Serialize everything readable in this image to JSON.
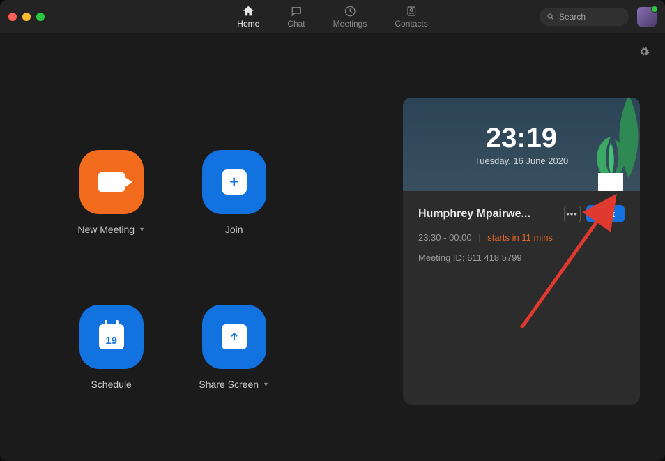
{
  "nav": {
    "tabs": [
      {
        "label": "Home"
      },
      {
        "label": "Chat"
      },
      {
        "label": "Meetings"
      },
      {
        "label": "Contacts"
      }
    ],
    "active_index": 0
  },
  "search": {
    "placeholder": "Search"
  },
  "tiles": {
    "new_meeting": {
      "label": "New Meeting"
    },
    "join": {
      "label": "Join"
    },
    "schedule": {
      "label": "Schedule",
      "calendar_day": "19"
    },
    "share_screen": {
      "label": "Share Screen"
    }
  },
  "clock": {
    "time": "23:19",
    "date": "Tuesday, 16 June 2020"
  },
  "upcoming_meeting": {
    "title": "Humphrey Mpairwe...",
    "time_range": "23:30 - 00:00",
    "countdown": "starts in 11 mins",
    "meeting_id_label": "Meeting ID:",
    "meeting_id": "611 418 5799",
    "start_label": "Start"
  },
  "colors": {
    "accent_blue": "#1272e0",
    "accent_orange": "#f36b1c",
    "warn": "#e06526"
  }
}
